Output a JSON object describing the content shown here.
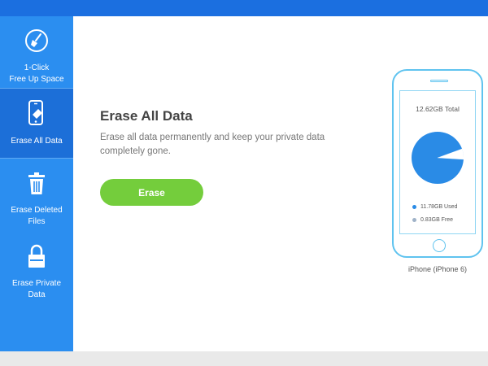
{
  "window": {
    "title": ""
  },
  "sidebar": {
    "items": [
      {
        "label": "1-Click\nFree Up Space",
        "icon": "broom-icon",
        "active": false
      },
      {
        "label": "Erase All Data",
        "icon": "phone-erase-icon",
        "active": true
      },
      {
        "label": "Erase Deleted\nFiles",
        "icon": "trash-icon",
        "active": false
      },
      {
        "label": "Erase Private\nData",
        "icon": "lock-icon",
        "active": false
      }
    ]
  },
  "main": {
    "title": "Erase All Data",
    "description": "Erase all data permanently and keep your private data completely gone.",
    "erase_button": "Erase"
  },
  "device": {
    "name": "iPhone (iPhone 6)",
    "storage_total": "12.62GB Total",
    "used_label": "11.78GB Used",
    "free_label": "0.83GB Free",
    "used_gb": 11.78,
    "free_gb": 0.83,
    "colors": {
      "used": "#2a8be6",
      "free": "#9fb2c8",
      "accent": "#2b8ef0",
      "button": "#74cd3c"
    }
  }
}
